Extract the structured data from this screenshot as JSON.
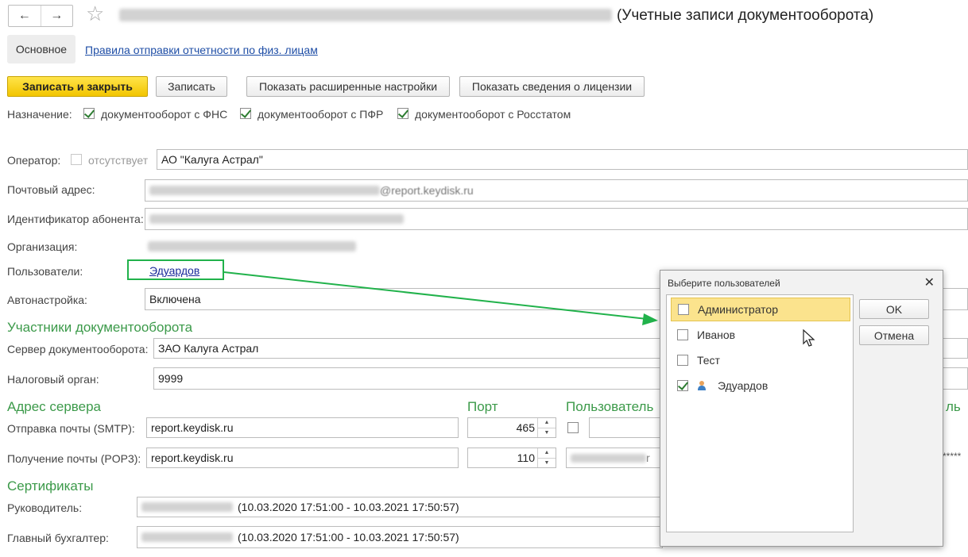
{
  "header": {
    "back_icon": "arrow-left-icon",
    "forward_icon": "arrow-right-icon",
    "favorite_icon": "star-icon",
    "title": "(Учетные записи документооборота)"
  },
  "tabs": {
    "main": "Основное",
    "rules_link": "Правила отправки отчетности по физ. лицам"
  },
  "toolbar": {
    "save_close": "Записать и закрыть",
    "save": "Записать",
    "show_advanced": "Показать расширенные настройки",
    "show_license": "Показать сведения о лицензии"
  },
  "purpose": {
    "label": "Назначение:",
    "fns": "документооборот с ФНС",
    "pfr": "документооборот с ПФР",
    "rosstat": "документооборот с Росстатом"
  },
  "form": {
    "operator_label": "Оператор:",
    "operator_absent": "отсутствует",
    "operator_value": "АО \"Калуга Астрал\"",
    "email_label": "Почтовый адрес:",
    "email_suffix": "@report.keydisk.ru",
    "subscriber_label": "Идентификатор абонента:",
    "org_label": "Организация:",
    "users_label": "Пользователи:",
    "users_value": "Эдуардов",
    "autoconfig_label": "Автонастройка:",
    "autoconfig_value": "Включена"
  },
  "participants": {
    "title": "Участники документооборота",
    "server_label": "Сервер документооборота:",
    "server_value": "ЗАО Калуга Астрал",
    "tax_label": "Налоговый орган:",
    "tax_value": "9999"
  },
  "server": {
    "title": "Адрес сервера",
    "port_header": "Порт",
    "user_header": "Пользователь",
    "password_header_tail": "ль",
    "smtp_label": "Отправка почты (SMTP):",
    "smtp_host": "report.keydisk.ru",
    "smtp_port": "465",
    "pop3_label": "Получение почты (POP3):",
    "pop3_host": "report.keydisk.ru",
    "pop3_port": "110",
    "pop3_user_tail": "r",
    "password_mask": "*****"
  },
  "certs": {
    "title": "Сертификаты",
    "head_label": "Руководитель:",
    "head_value": "(10.03.2020 17:51:00 - 10.03.2021 17:50:57)",
    "accountant_label": "Главный бухгалтер:",
    "accountant_value": "(10.03.2020 17:51:00 - 10.03.2021 17:50:57)"
  },
  "dialog": {
    "title": "Выберите пользователей",
    "close_icon": "close-icon",
    "items": [
      {
        "label": "Администратор",
        "checked": false,
        "selected": true
      },
      {
        "label": "Иванов",
        "checked": false,
        "selected": false
      },
      {
        "label": "Тест",
        "checked": false,
        "selected": false
      },
      {
        "label": "Эдуардов",
        "checked": true,
        "selected": false,
        "icon": "user-icon"
      }
    ],
    "ok": "OK",
    "cancel": "Отмена"
  },
  "colors": {
    "accent_green": "#3c9a4a",
    "primary_button": "#f2c500",
    "annotation": "#21b24b"
  }
}
